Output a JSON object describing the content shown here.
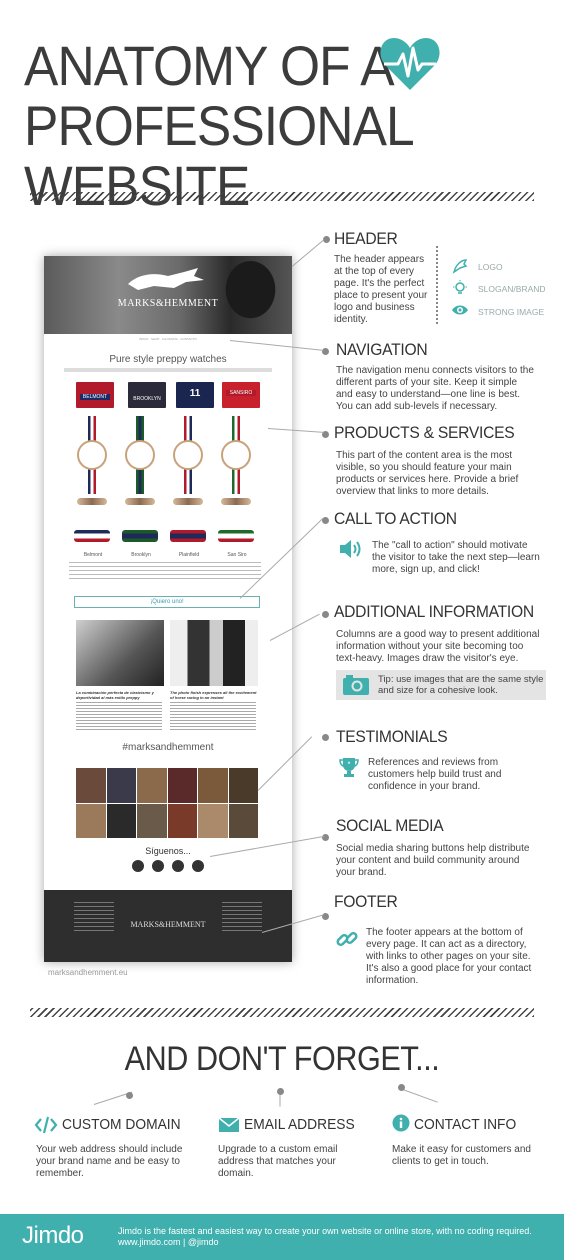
{
  "title": {
    "line1": "ANATOMY OF A",
    "line2": "PROFESSIONAL  WEBSITE"
  },
  "colors": {
    "accent": "#3fb0ad",
    "text": "#3c3c3c",
    "muted": "#9aa0a0"
  },
  "mock_site": {
    "brand": "MARKS&HEMMENT",
    "nav": "INICIO · SHOP · FILOSOFÍA · CONTACTO",
    "headline": "Pure style preppy watches",
    "products": [
      "Belmont",
      "Brooklyn",
      "Plainfield",
      "San Siro"
    ],
    "tiles": [
      "BELMONT",
      "BROOKLYN",
      "11",
      "SANSIRO"
    ],
    "cta": "¡Quiero uno!",
    "caption_left": "La combinación perfecta de clasicismo y deportividad al más estilo preppy",
    "caption_right": "The photo finish expresses all the excitement of horse racing in an instant",
    "hashtag": "#marksandhemment",
    "follow": "Síguenos...",
    "url": "marksandhemment.eu"
  },
  "sections": {
    "header": {
      "heading": "HEADER",
      "text": "The header appears at the top of every page. It's the perfect place to present your logo and business identity.",
      "legend": [
        {
          "icon": "logo-icon",
          "label": "LOGO"
        },
        {
          "icon": "bulb-icon",
          "label": "SLOGAN/BRAND"
        },
        {
          "icon": "eye-icon",
          "label": "STRONG IMAGE"
        }
      ]
    },
    "navigation": {
      "heading": "NAVIGATION",
      "text": "The navigation menu connects visitors to the different parts of your site. Keep it simple and easy to understand—one line is best. You can add sub-levels if necessary."
    },
    "products": {
      "heading": "PRODUCTS & SERVICES",
      "text": "This part of the content area is the most visible, so you should feature your main products or services here. Provide a brief overview that links to more details."
    },
    "cta": {
      "heading": "CALL TO ACTION",
      "text": "The \"call to action\" should motivate the visitor to take the next step—learn more, sign up, and click!"
    },
    "additional": {
      "heading": "ADDITIONAL INFORMATION",
      "text": "Columns are a good way to present additional information without your site becoming too text-heavy. Images draw the visitor's eye.",
      "tip": "Tip: use images that are the same style and size for a cohesive look."
    },
    "testimonials": {
      "heading": "TESTIMONIALS",
      "text": "References and reviews from customers help build trust and confidence in your brand."
    },
    "social": {
      "heading": "SOCIAL MEDIA",
      "text": "Social media sharing buttons help distribute your content and build community around your brand."
    },
    "footer": {
      "heading": "FOOTER",
      "text": "The footer appears at the bottom of every page. It can act as a directory, with links to other pages on your site. It's also a good place for your contact information."
    }
  },
  "dont_forget": {
    "heading": "AND DON'T FORGET...",
    "items": [
      {
        "icon": "code-icon",
        "title": "CUSTOM DOMAIN",
        "text": "Your web address should include your brand name and be easy to remember."
      },
      {
        "icon": "envelope-icon",
        "title": "EMAIL ADDRESS",
        "text": "Upgrade to a custom email address that matches your domain."
      },
      {
        "icon": "info-icon",
        "title": "CONTACT INFO",
        "text": "Make it easy for customers and clients to get in touch."
      }
    ]
  },
  "footer_bar": {
    "logo": "Jimdo",
    "tagline": "Jimdo is the fastest and easiest way to create your own website or online store, with no coding required.",
    "links": "www.jimdo.com | @jimdo"
  }
}
